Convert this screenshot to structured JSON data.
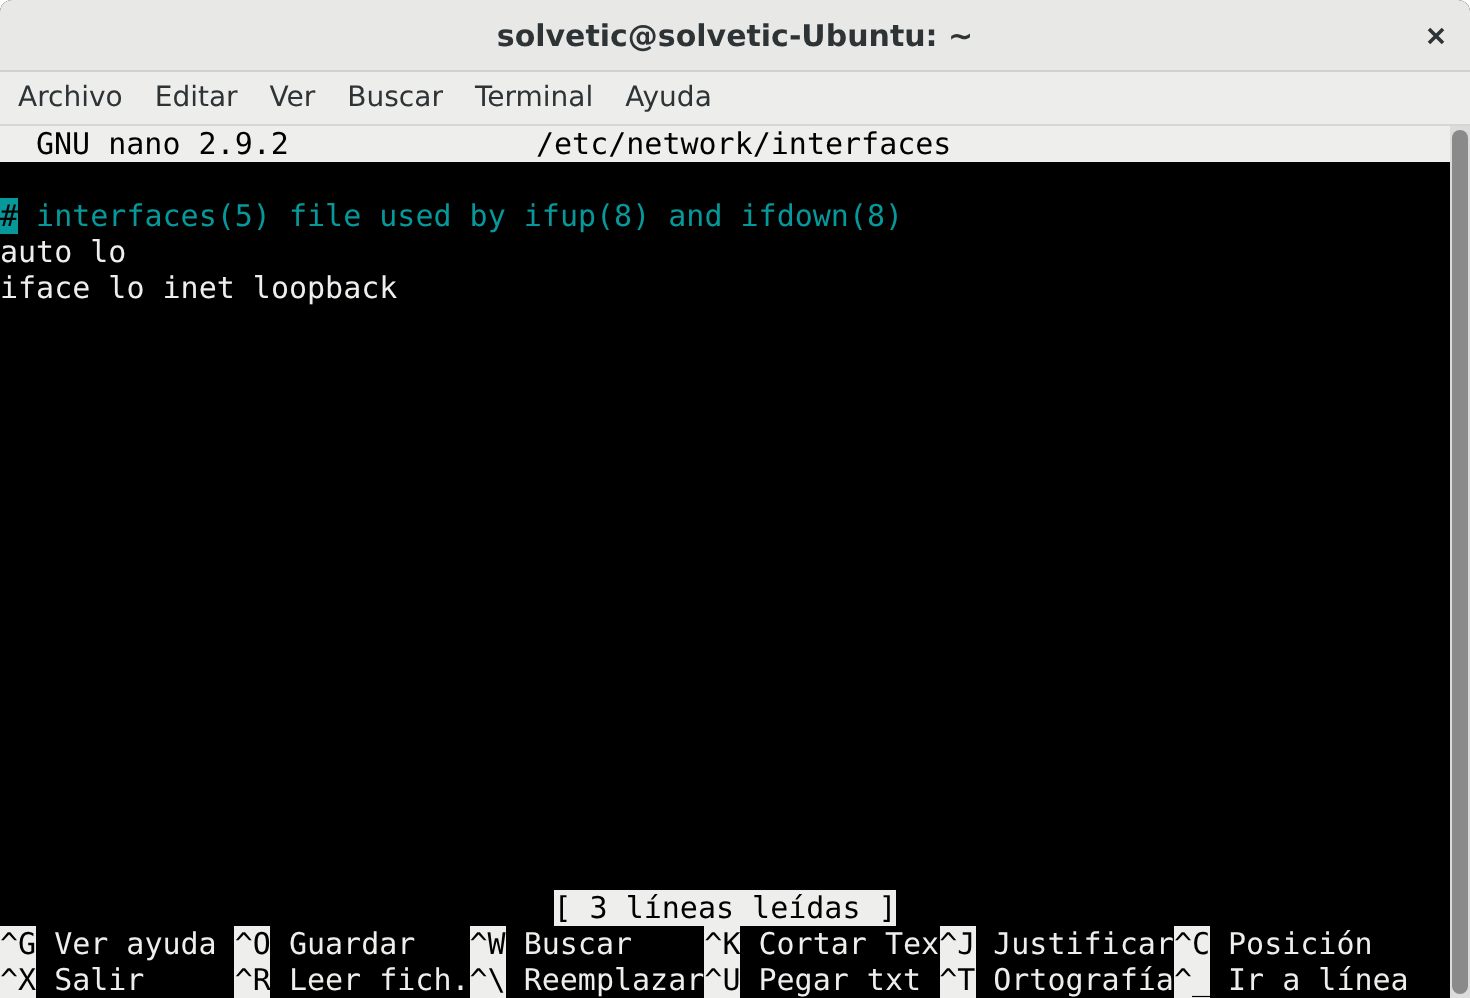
{
  "window": {
    "title": "solvetic@solvetic-Ubuntu: ~"
  },
  "menu": [
    "Archivo",
    "Editar",
    "Ver",
    "Buscar",
    "Terminal",
    "Ayuda"
  ],
  "nano": {
    "version": "GNU nano 2.9.2",
    "filename": "/etc/network/interfaces",
    "lines": [
      {
        "kind": "comment",
        "text": "# interfaces(5) file used by ifup(8) and ifdown(8)",
        "has_cursor": true
      },
      {
        "kind": "plain",
        "text": "auto lo",
        "has_cursor": false
      },
      {
        "kind": "plain",
        "text": "iface lo inet loopback",
        "has_cursor": false
      }
    ],
    "status": "[ 3 líneas leídas ]",
    "shortcut_rows": [
      [
        {
          "key": "^G",
          "label": "Ver ayuda"
        },
        {
          "key": "^O",
          "label": "Guardar"
        },
        {
          "key": "^W",
          "label": "Buscar"
        },
        {
          "key": "^K",
          "label": "Cortar Tex"
        },
        {
          "key": "^J",
          "label": "Justificar"
        },
        {
          "key": "^C",
          "label": "Posición"
        }
      ],
      [
        {
          "key": "^X",
          "label": "Salir"
        },
        {
          "key": "^R",
          "label": "Leer fich."
        },
        {
          "key": "^\\",
          "label": "Reemplazar"
        },
        {
          "key": "^U",
          "label": "Pegar txt"
        },
        {
          "key": "^T",
          "label": "Ortografía"
        },
        {
          "key": "^_",
          "label": "Ir a línea"
        }
      ]
    ]
  }
}
